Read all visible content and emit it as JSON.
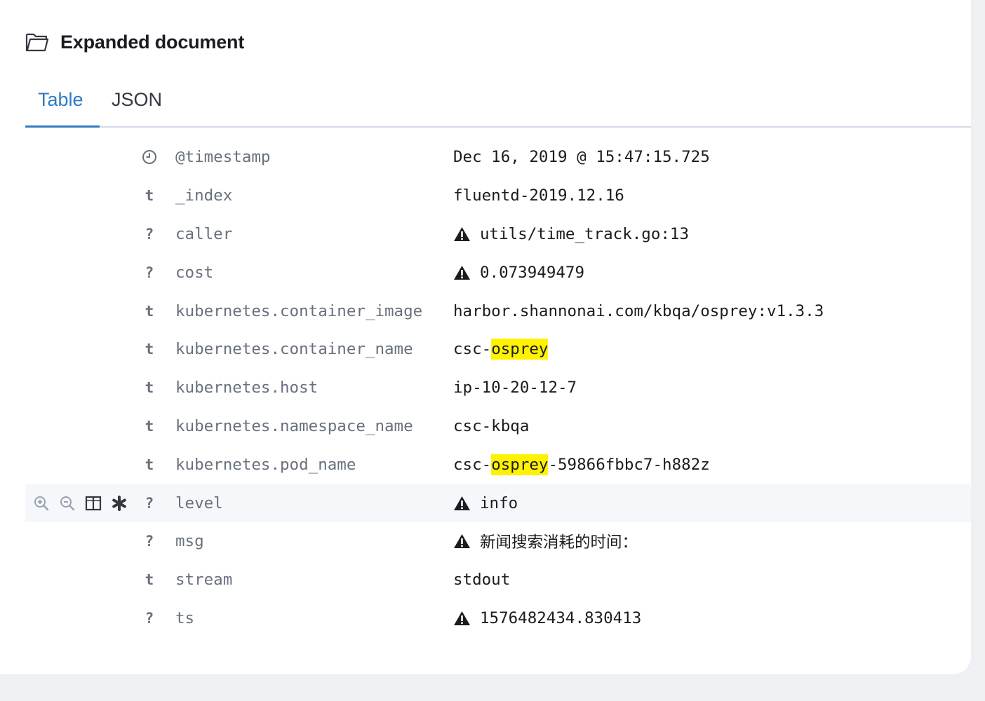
{
  "header": {
    "title": "Expanded document",
    "icon": "folder-open-icon"
  },
  "tabs": [
    {
      "label": "Table",
      "active": true
    },
    {
      "label": "JSON",
      "active": false
    }
  ],
  "colors": {
    "accent": "#2f7bc1",
    "highlight": "#fff200",
    "field_name": "#69707d",
    "value_text": "#1a1c21"
  },
  "rows": [
    {
      "type": "clock",
      "type_glyph": "",
      "field": "@timestamp",
      "value": "Dec 16, 2019 @ 15:47:15.725",
      "warning": false
    },
    {
      "type": "string",
      "type_glyph": "t",
      "field": "_index",
      "value": "fluentd-2019.12.16",
      "warning": false
    },
    {
      "type": "unknown",
      "type_glyph": "?",
      "field": "caller",
      "value": "utils/time_track.go:13",
      "warning": true
    },
    {
      "type": "unknown",
      "type_glyph": "?",
      "field": "cost",
      "value": "0.073949479",
      "warning": true
    },
    {
      "type": "string",
      "type_glyph": "t",
      "field": "kubernetes.container_image",
      "value": "harbor.shannonai.com/kbqa/osprey:v1.3.3",
      "warning": false
    },
    {
      "type": "string",
      "type_glyph": "t",
      "field": "kubernetes.container_name",
      "value_pre": "csc-",
      "value_hl": "osprey",
      "value_post": "",
      "warning": false
    },
    {
      "type": "string",
      "type_glyph": "t",
      "field": "kubernetes.host",
      "value": "ip-10-20-12-7",
      "warning": false
    },
    {
      "type": "string",
      "type_glyph": "t",
      "field": "kubernetes.namespace_name",
      "value": "csc-kbqa",
      "warning": false
    },
    {
      "type": "string",
      "type_glyph": "t",
      "field": "kubernetes.pod_name",
      "value_pre": "csc-",
      "value_hl": "osprey",
      "value_post": "-59866fbbc7-h882z",
      "warning": false
    },
    {
      "type": "unknown",
      "type_glyph": "?",
      "field": "level",
      "value": "info",
      "warning": true,
      "hover": true
    },
    {
      "type": "unknown",
      "type_glyph": "?",
      "field": "msg",
      "value": "新闻搜索消耗的时间：",
      "warning": true
    },
    {
      "type": "string",
      "type_glyph": "t",
      "field": "stream",
      "value": "stdout",
      "warning": false
    },
    {
      "type": "unknown",
      "type_glyph": "?",
      "field": "ts",
      "value": "1576482434.830413",
      "warning": true
    }
  ],
  "row_actions": [
    "filter-for-value-icon",
    "filter-out-value-icon",
    "toggle-column-icon",
    "filter-exists-icon"
  ]
}
